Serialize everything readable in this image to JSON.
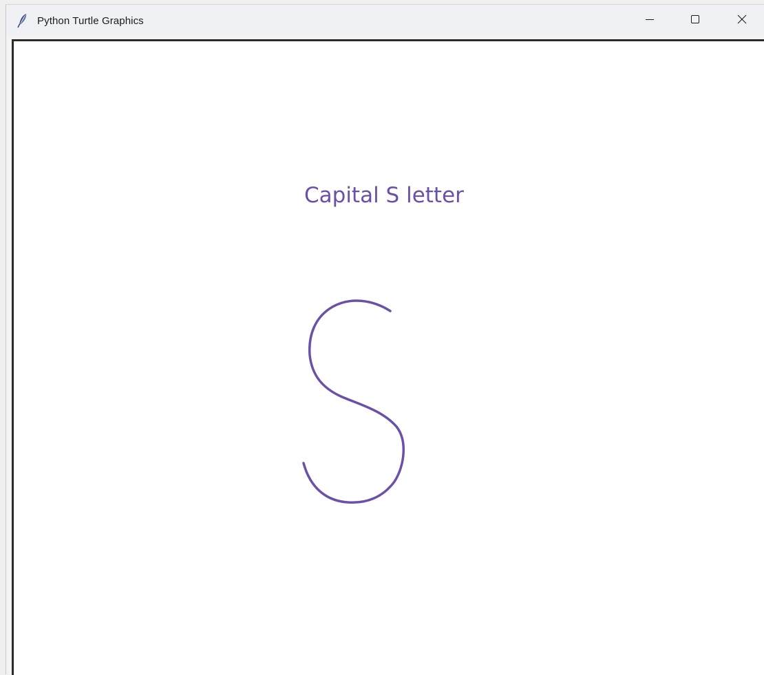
{
  "window": {
    "title": "Python Turtle Graphics",
    "icons": {
      "app": "feather-icon",
      "minimize": "minimize-icon",
      "maximize": "maximize-icon",
      "close": "close-icon"
    }
  },
  "canvas": {
    "background": "#ffffff",
    "label": "Capital S letter",
    "pen_color": "#6a50a7"
  }
}
